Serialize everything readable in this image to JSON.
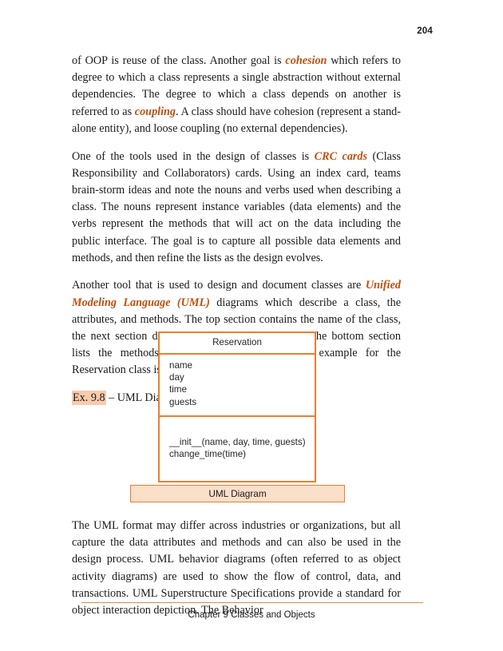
{
  "page": {
    "number": "204",
    "footer_text": "Chapter 9 Classes and Objects"
  },
  "colors": {
    "accent_orange": "#ED7D31",
    "emphasis_orange": "#C0500F",
    "highlight_peach": "#F8CBAD",
    "caption_fill": "#FADFC9",
    "footer_rule": "#E08B3F"
  },
  "paragraphs": {
    "p1": {
      "seg1": "of OOP is reuse of the class.  Another goal is ",
      "em1": "cohesion",
      "seg2": " which refers to degree to which a class represents a single abstraction without external dependencies.  The degree to which a class depends on another is referred to as ",
      "em2": "coupling",
      "seg3": ".  A class should have cohesion (represent a stand-alone entity), and loose coupling (no external dependencies)."
    },
    "p2": {
      "seg1": "One of the tools used in the design of classes is ",
      "em1": "CRC cards",
      "seg2": " (Class Responsibility and Collaborators) cards.  Using an index card, teams brain-storm ideas and note the nouns and verbs used when describing a class.  The nouns represent instance variables (data elements) and the verbs represent the methods that will act on the data including the public interface.  The goal is to capture all possible data elements and methods, and then refine the lists as the design evolves."
    },
    "p3": {
      "seg1": "Another tool that is used to design and document classes are ",
      "em1": "Unified Modeling Language (UML)",
      "seg2": " diagrams which describe a class, the attributes, and methods. The top section contains the name of the class, the next section describes the data attributes, and the bottom section lists the methods for the class.  A generalized example for the Reservation class is shown here."
    },
    "p4": {
      "text": "The UML format may differ across industries or organizations, but all capture the data attributes and methods and can also be used in the design process. UML behavior diagrams (often referred to as object activity diagrams) are used to show the flow of control, data, and transactions. UML Superstructure Specifications provide a standard for object interaction depiction.  The Behavior"
    }
  },
  "example": {
    "tag": "Ex. 9.8",
    "title": " – UML Diagram"
  },
  "uml_diagram": {
    "class_name": "Reservation",
    "attributes": [
      "name",
      "day",
      "time",
      "guests"
    ],
    "methods": [
      "__init__(name, day, time, guests)",
      "change_time(time)"
    ],
    "caption": "UML Diagram"
  }
}
